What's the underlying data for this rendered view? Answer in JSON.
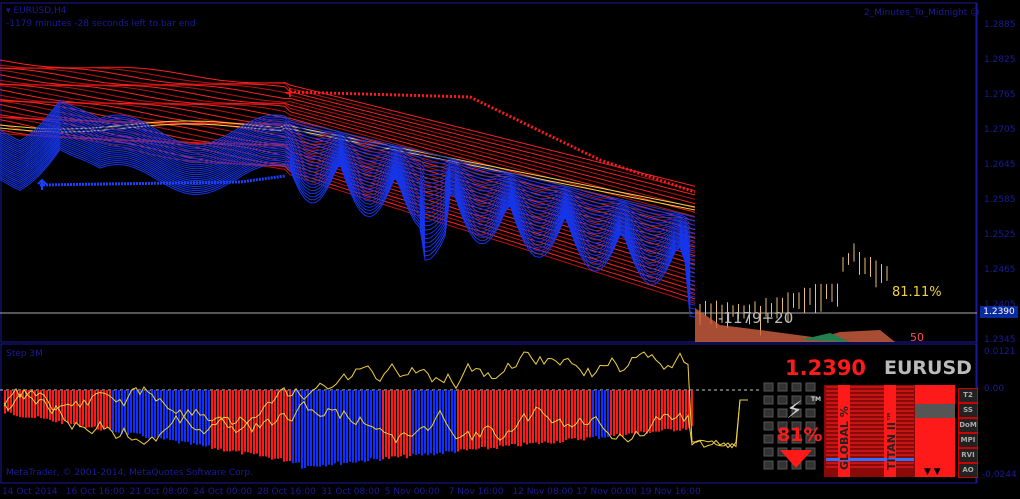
{
  "header": {
    "symbol": "EURUSD,H4",
    "countdown": "-1179 minutes -28 seconds left to bar end",
    "indicator_name": "2_Minutes_To_Midnight"
  },
  "price_axis": [
    "1.2885",
    "1.2825",
    "1.2765",
    "1.2705",
    "1.2645",
    "1.2585",
    "1.2525",
    "1.2465",
    "1.2405",
    "1.2345"
  ],
  "current_price": "1.2390",
  "chart_labels": {
    "probability": "81.11%",
    "counter": "-1179+20",
    "level": "50"
  },
  "sub_window": {
    "name": "Step 3M",
    "axis": [
      "0.0121",
      "0.00",
      "-0.0244"
    ],
    "copyright": "MetaTrader, © 2001-2014, MetaQuotes Software Corp."
  },
  "time_axis": [
    "14 Oct 2014",
    "16 Oct 16:00",
    "21 Oct 08:00",
    "24 Oct 00:00",
    "28 Oct 16:00",
    "31 Oct 08:00",
    "5 Nov 00:00",
    "7 Nov 16:00",
    "12 Nov 08:00",
    "17 Nov 00:00",
    "19 Nov 16:00"
  ],
  "panel": {
    "price": "1.2390",
    "symbol": "EURUSD",
    "percent": "81%",
    "tm": "TM",
    "global_label": "GLOBAL %",
    "titan_label": "TITAN II™",
    "buttons": [
      "T2",
      "SS",
      "DoM",
      "MPI",
      "RVI",
      "AO"
    ]
  },
  "colors": {
    "bull": "#ff1a1a",
    "bear": "#1030ff",
    "axis": "#1a1a9a",
    "yellow": "#f0d040"
  }
}
